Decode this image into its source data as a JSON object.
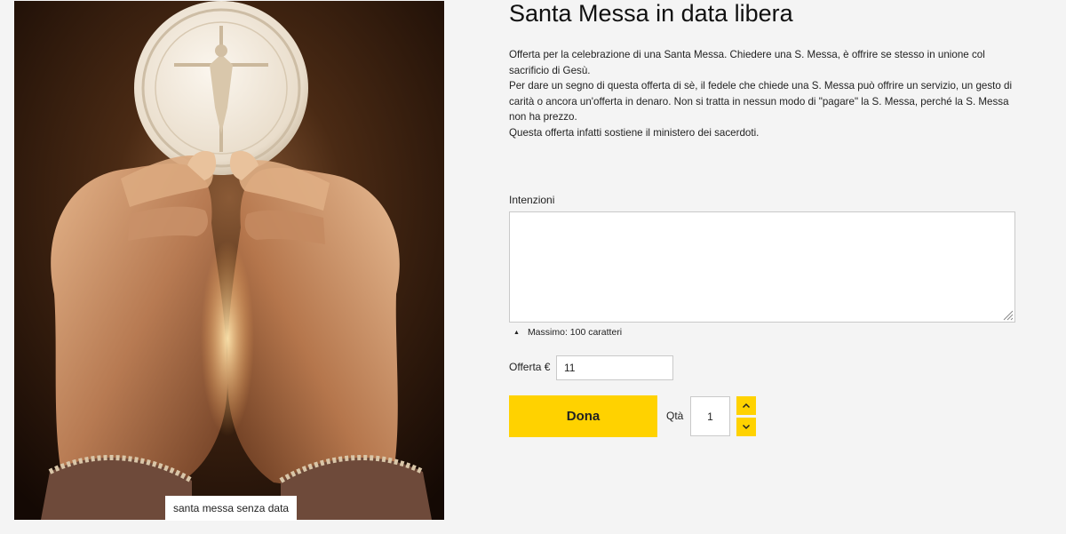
{
  "product": {
    "title": "Santa Messa in data libera",
    "image_caption": "santa messa senza data",
    "description": [
      "Offerta per la celebrazione di una Santa Messa. Chiedere una S. Messa, è offrire se stesso in unione col sacrificio di Gesù.",
      "Per dare un segno di questa offerta di sè, il fedele che chiede una S. Messa può offrire un servizio, un gesto di carità o ancora un'offerta in denaro. Non si tratta in nessun modo di \"pagare\" la S. Messa, perché la S. Messa non ha prezzo.",
      "Questa offerta infatti sostiene il ministero dei sacerdoti."
    ]
  },
  "form": {
    "intentions_label": "Intenzioni",
    "intentions_value": "",
    "char_limit_text": "Massimo: 100 caratteri",
    "offer_label": "Offerta €",
    "offer_value": "11",
    "donate_label": "Dona",
    "qty_label": "Qtà",
    "qty_value": "1"
  },
  "icons": {
    "char_limit": "triangle-up-icon",
    "qty_up": "chevron-up-icon",
    "qty_down": "chevron-down-icon",
    "resize": "resize-grip-icon"
  },
  "colors": {
    "accent": "#ffd200",
    "background": "#f4f4f4",
    "border": "#c9c9c9"
  }
}
